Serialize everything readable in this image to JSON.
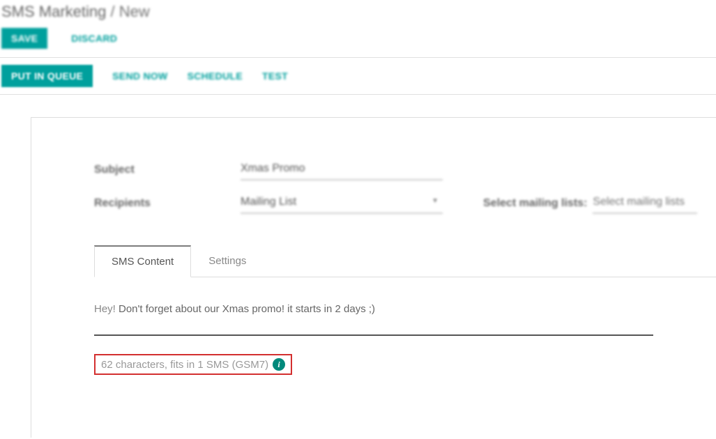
{
  "breadcrumb": {
    "main": "SMS Marketing",
    "sep": "/",
    "current": "New"
  },
  "topButtons": {
    "save": "SAVE",
    "discard": "DISCARD"
  },
  "actions": {
    "queue": "PUT IN QUEUE",
    "sendNow": "SEND NOW",
    "schedule": "SCHEDULE",
    "test": "TEST"
  },
  "form": {
    "subjectLabel": "Subject",
    "subjectValue": "Xmas Promo",
    "recipientsLabel": "Recipients",
    "recipientsValue": "Mailing List",
    "selectLabel": "Select mailing lists:",
    "selectPlaceholder": "Select mailing lists"
  },
  "tabs": {
    "content": "SMS Content",
    "settings": "Settings"
  },
  "sms": {
    "hey": "Hey!",
    "body": " Don't forget about our Xmas promo! it starts in 2 days ;)",
    "charCount": "62 characters, fits in 1 SMS (GSM7)"
  }
}
